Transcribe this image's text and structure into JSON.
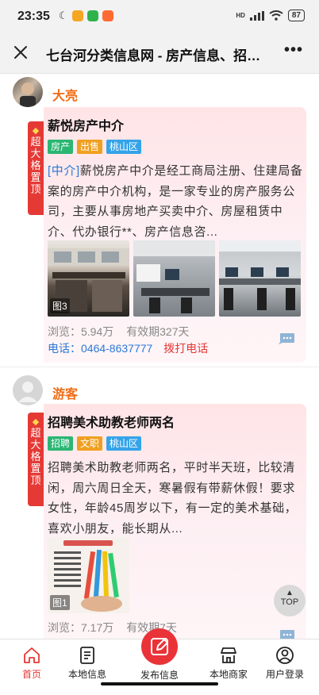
{
  "status_bar": {
    "time": "23:35",
    "battery": "87",
    "network": "HD"
  },
  "title_bar": {
    "title": "七台河分类信息网 - 房产信息、招聘信息、家政服务"
  },
  "posts": [
    {
      "user": "大亮",
      "ribbon": "超大格置顶",
      "title": "薪悦房产中介",
      "tags": [
        {
          "label": "房产",
          "color": "#2bb673"
        },
        {
          "label": "出售",
          "color": "#f0a020"
        },
        {
          "label": "桃山区",
          "color": "#35a3e8"
        }
      ],
      "category": "[中介]",
      "description": "薪悦房产中介是经工商局注册、住建局备案的房产中介机构，是一家专业的房产服务公司，主要从事房地产买卖中介、房屋租赁中介、代办银行**、房产信息咨...",
      "photo_count": "图3",
      "views": "浏览：5.94万",
      "validity": "有效期327天",
      "phone": "电话：0464-8637777",
      "dial": "拨打电话"
    },
    {
      "user": "游客",
      "ribbon": "超大格置顶",
      "title": "招聘美术助教老师两名",
      "tags": [
        {
          "label": "招聘",
          "color": "#2bb673"
        },
        {
          "label": "文职",
          "color": "#f0a020"
        },
        {
          "label": "桃山区",
          "color": "#35a3e8"
        }
      ],
      "description": "招聘美术助教老师两名，平时半天班，比较清闲，周六周日全天，寒暑假有带薪休假！要求女性，年龄45周岁以下，有一定的美术基础，喜欢小朋友，能长期从...",
      "photo_count": "图1",
      "views": "浏览：7.17万",
      "validity": "有效期7天"
    }
  ],
  "top_button": "TOP",
  "nav": {
    "home": "首页",
    "local_info": "本地信息",
    "publish": "发布信息",
    "local_merchants": "本地商家",
    "login": "用户登录"
  },
  "colors": {
    "accent": "#e53935",
    "username": "#f06c14",
    "link": "#2b79d6"
  }
}
